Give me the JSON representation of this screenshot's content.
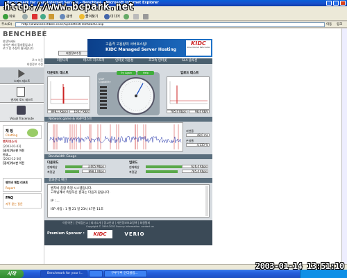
{
  "window": {
    "title": "Benchmark for your Internet Service - Benchbee - Microsoft Internet Explorer"
  },
  "watermark": "http://www.bcpark.net",
  "menu": [
    "파일(F)",
    "편집(E)",
    "보기(V)",
    "즐겨찾기(A)",
    "도구(T)",
    "도움말(H)"
  ],
  "toolbar": {
    "back": "뒤로",
    "search": "검색",
    "favorites": "즐겨찾기",
    "media": "미디어"
  },
  "address": {
    "label": "주소(D)",
    "url": "http://www.benchbee.co.kr/Speedtest/TestStart2.asp",
    "go": "이동",
    "links": "링크"
  },
  "site": {
    "logo": "BENCHBEE",
    "login": {
      "lines": [
        "안녕하세요",
        "다이슨 께서 접속중입니다",
        "로그 인 수정이 필요합니다"
      ],
      "button": "회원정보수정"
    },
    "banner": {
      "line1": "고품격 고용량의 서버호스팅!",
      "line2": "KIDC Managed Server Hosting",
      "logo": "KIDC",
      "sub": "Korea Internet Data Center"
    },
    "nav": [
      "커뮤니티",
      "테스트 히스토리",
      "인터넷 가용성",
      "초고속 인터넷",
      "SLA 솔루션"
    ],
    "side_tabs": [
      {
        "label": "로그 아웃"
      },
      {
        "label": "회원정보 수정"
      }
    ],
    "side_menu": [
      {
        "label": "스피드 테스트"
      },
      {
        "label": "벤치비 로드 테스트"
      },
      {
        "label": "Visual Traceroute"
      }
    ],
    "chat": {
      "title": "채 팅",
      "sub": "Chatting"
    },
    "board": {
      "title": "벤치비소식",
      "items": [
        "[2003-01-03]",
        "[공지]개시판 이전",
        "안내...",
        "[2002-12-30]",
        "[공지]개시판 이전"
      ]
    },
    "report": {
      "title": "벤치비 체험 리포트",
      "sub": "Report"
    },
    "faq": {
      "title": "FAQ",
      "sub": "자주 묻는 질문"
    }
  },
  "speedtest": {
    "download_label": "다운로드 테스트",
    "upload_label": "업로드 테스트",
    "download_values": [
      "898,1 Kbps",
      "104,7 KB/s"
    ],
    "upload_values": [
      "785,4 Kbps",
      "98,4 KB/s"
    ],
    "voq_label": "VOIP Capability",
    "gauge_tabs": [
      "Try Again",
      "Help"
    ],
    "voip_label": "Network game & VoIP 테스트",
    "latency_label": "지연율",
    "latency_value": "48,0 ms",
    "loss_label": "손실율",
    "loss_value": "4,133 %",
    "bandwidth_label": "Bandwidth Gauge",
    "bw_download": {
      "title": "다운로드",
      "rows": [
        {
          "label": "현재예상",
          "value": "3,605 Mbps"
        },
        {
          "label": "측정값",
          "value": "898,1 Kbps"
        }
      ]
    },
    "bw_upload": {
      "title": "업로드",
      "rows": [
        {
          "label": "현재예상",
          "value": "626,4 Kbps"
        },
        {
          "label": "측정값",
          "value": "785,4 Kbps"
        }
      ]
    },
    "result_label": "결과분석 확인",
    "result_text": [
      "벤치비 종합 측정 시스템입니다.",
      "고객님께서 측정하신 결과는 다음과 같습니다.",
      "",
      "IP : ...",
      "",
      "ISP 사업 :    1 월 21 일  23시  47분 11초"
    ],
    "footer_links": [
      "이용약관",
      "문제점신고",
      "회사소개",
      "광고안내",
      "개인정보보호정책",
      "회원탈퇴"
    ],
    "copyright": "Copyright © 1999-2002 Ssunny Information. contact us",
    "sponsor_label": "Premium Sponsor :",
    "sponsor1": "KIDC",
    "sponsor2": "VERIO"
  },
  "taskbar": {
    "start": "시작",
    "tasks": [
      "Benchmark for your I...",
      "",
      "구루구루 인디클럽..."
    ]
  },
  "timestamp": "2003-01-14 13:51:10",
  "colors": {
    "gauge_green": "#3fae3a",
    "nav": "#4a5f6e",
    "bw_bar": "#5aa84a"
  }
}
